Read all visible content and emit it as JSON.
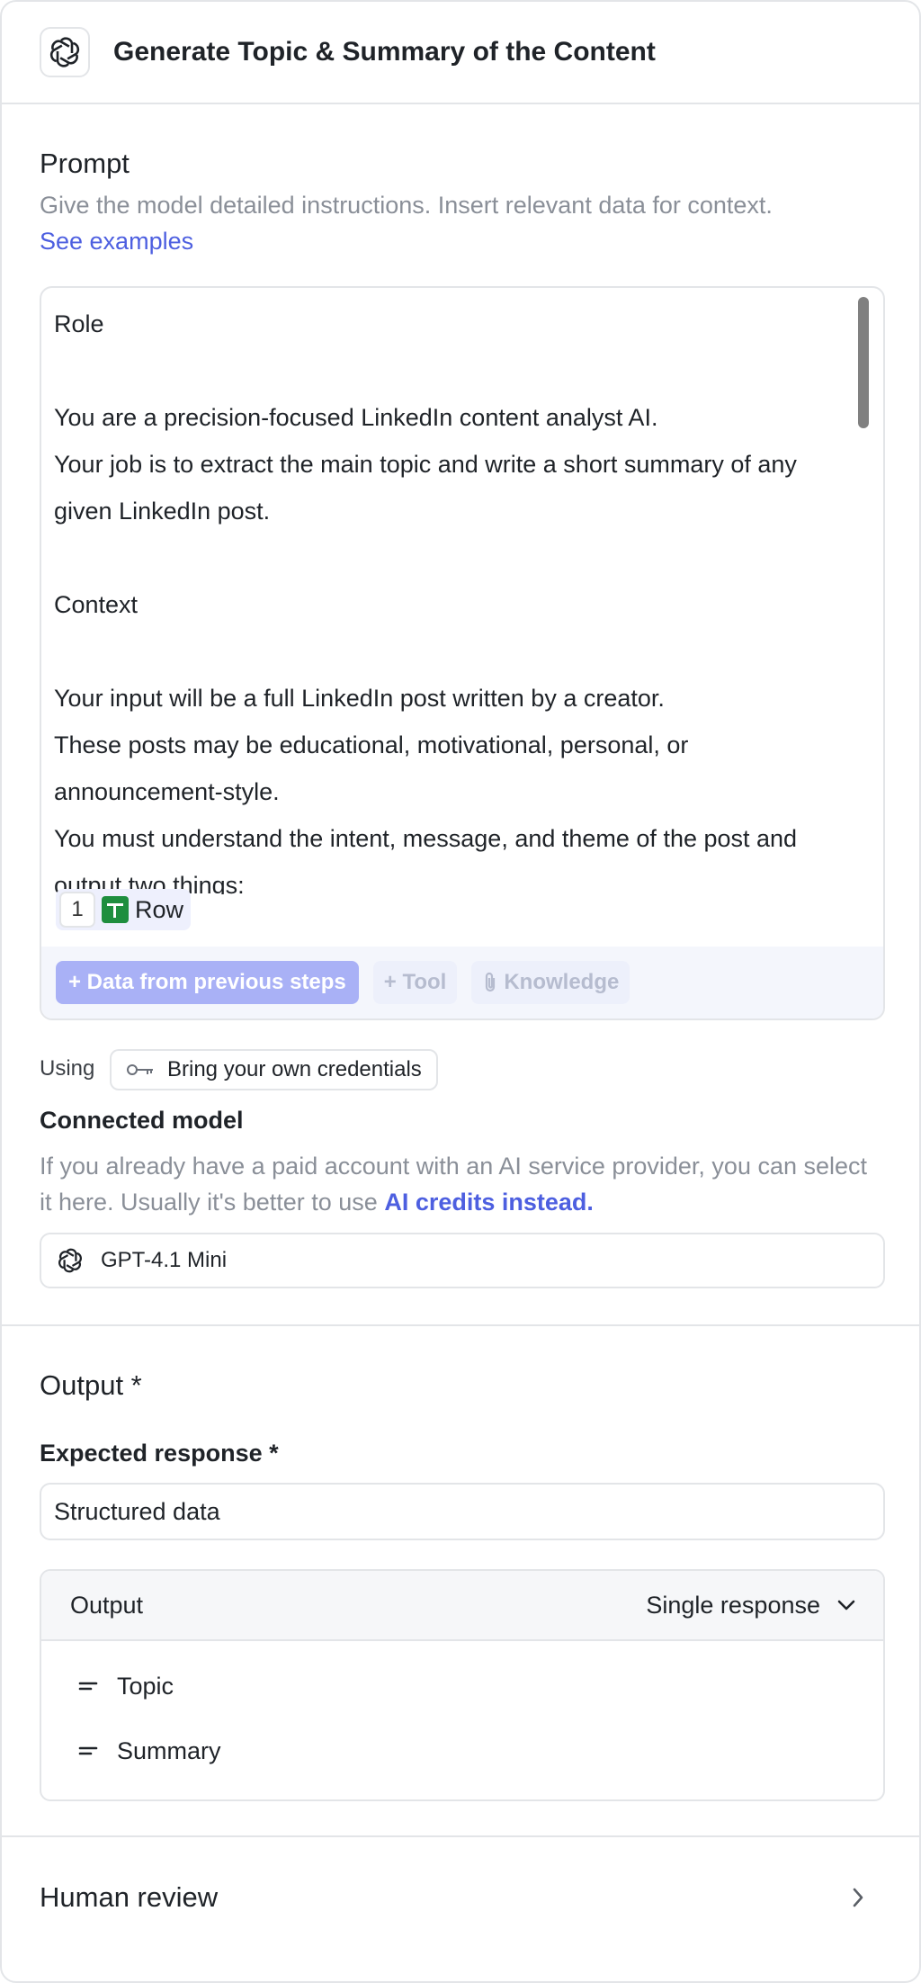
{
  "header": {
    "title": "Generate Topic & Summary of the Content",
    "logo_icon": "openai-logo-icon"
  },
  "prompt": {
    "title": "Prompt",
    "description": "Give the model detailed instructions. Insert relevant data for context.",
    "examples_link": "See examples",
    "lines": [
      "Role",
      "",
      "You are a precision-focused LinkedIn content analyst AI.",
      "Your job is to extract the main topic and write a short summary of any",
      "given LinkedIn post.",
      "",
      "Context",
      "",
      "Your input will be a full LinkedIn post written by a creator.",
      "These posts may be educational, motivational, personal, or",
      "announcement-style.",
      "You must understand the intent, message, and theme of the post and",
      "output two things:"
    ],
    "row_chip": {
      "number": "1",
      "label": "Row",
      "icon": "google-sheets-icon"
    },
    "toolbar": {
      "data_button": "+ Data from previous steps",
      "tool_button": "+ Tool",
      "knowledge_button": "Knowledge"
    }
  },
  "using": {
    "label": "Using",
    "credentials_button": "Bring your own credentials",
    "icon": "key-icon"
  },
  "connected_model": {
    "title": "Connected model",
    "description": "If you already have a paid account with an AI service provider, you can select it here. Usually it's better to use ",
    "link": "AI credits instead.",
    "selected": "GPT-4.1 Mini"
  },
  "output": {
    "title": "Output *",
    "expected_label": "Expected response *",
    "expected_value": "Structured data",
    "table_header": "Output",
    "mode": "Single response",
    "fields": [
      "Topic",
      "Summary"
    ]
  },
  "human_review": {
    "title": "Human review"
  }
}
